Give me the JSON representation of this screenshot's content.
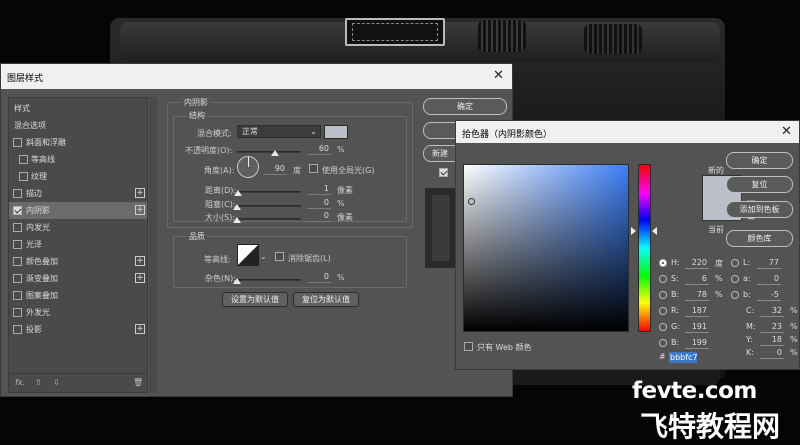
{
  "layer_style": {
    "title": "图层样式",
    "close": "✕",
    "list": [
      {
        "label": "样式",
        "kind": "header"
      },
      {
        "label": "混合选项",
        "kind": "header"
      },
      {
        "label": "斜面和浮雕",
        "kind": "check",
        "checked": false
      },
      {
        "label": "等高线",
        "kind": "subcheck",
        "checked": false
      },
      {
        "label": "纹理",
        "kind": "subcheck",
        "checked": false
      },
      {
        "label": "描边",
        "kind": "check",
        "checked": false,
        "plus": "+"
      },
      {
        "label": "内阴影",
        "kind": "check",
        "checked": true,
        "plus": "+",
        "selected": true
      },
      {
        "label": "内发光",
        "kind": "check",
        "checked": false
      },
      {
        "label": "光泽",
        "kind": "check",
        "checked": false
      },
      {
        "label": "颜色叠加",
        "kind": "check",
        "checked": false,
        "plus": "+"
      },
      {
        "label": "渐变叠加",
        "kind": "check",
        "checked": false,
        "plus": "+"
      },
      {
        "label": "图案叠加",
        "kind": "check",
        "checked": false
      },
      {
        "label": "外发光",
        "kind": "check",
        "checked": false
      },
      {
        "label": "投影",
        "kind": "check",
        "checked": false,
        "plus": "+"
      }
    ],
    "footer": {
      "fx": "fx.",
      "up": "⇧",
      "down": "⇩",
      "trash": "🗑"
    },
    "inner_shadow": {
      "heading": "内阴影",
      "structure": "结构",
      "blend_mode_label": "混合模式:",
      "blend_mode_value": "正常",
      "opacity_label": "不透明度(O):",
      "opacity_value": "60",
      "angle_label": "角度(A):",
      "angle_value": "90",
      "angle_unit": "度",
      "global_light_label": "使用全局光(G)",
      "distance_label": "距离(D):",
      "distance_value": "1",
      "choke_label": "阻塞(C):",
      "choke_value": "0",
      "size_label": "大小(S):",
      "size_value": "0",
      "px_unit": "像素",
      "pct_unit": "%",
      "quality": "品质",
      "contour_label": "等高线:",
      "antialias_label": "消除锯齿(L)",
      "noise_label": "杂色(N):",
      "noise_value": "0",
      "set_default": "设置为默认值",
      "reset_default": "复位为默认值",
      "opacity_fraction": 0.6,
      "distance_fraction": 0.02,
      "choke_fraction": 0,
      "size_fraction": 0,
      "noise_fraction": 0
    },
    "buttons": {
      "ok": "确定",
      "new_style": "新建"
    },
    "swatch_color": "#bbbfc7"
  },
  "picker": {
    "title": "拾色器（内阴影颜色）",
    "close": "✕",
    "new_label": "新的",
    "current_label": "当前",
    "buttons": [
      "确定",
      "复位",
      "添加到色板",
      "颜色库"
    ],
    "web_only_label": "只有 Web 颜色",
    "hsb": [
      {
        "k": "H:",
        "v": "220",
        "u": "度",
        "on": true
      },
      {
        "k": "S:",
        "v": "6",
        "u": "%",
        "on": false
      },
      {
        "k": "B:",
        "v": "78",
        "u": "%",
        "on": false
      }
    ],
    "rgb": [
      {
        "k": "R:",
        "v": "187",
        "on": false
      },
      {
        "k": "G:",
        "v": "191",
        "on": false
      },
      {
        "k": "B:",
        "v": "199",
        "on": false
      }
    ],
    "lab": [
      {
        "k": "L:",
        "v": "77"
      },
      {
        "k": "a:",
        "v": "0"
      },
      {
        "k": "b:",
        "v": "-5"
      }
    ],
    "cmyk": [
      {
        "k": "C:",
        "v": "32",
        "u": "%"
      },
      {
        "k": "M:",
        "v": "23",
        "u": "%"
      },
      {
        "k": "Y:",
        "v": "18",
        "u": "%"
      },
      {
        "k": "K:",
        "v": "0",
        "u": "%"
      }
    ],
    "hash": "#",
    "hex": "bbbfc7",
    "color": "#bbbfc7"
  },
  "watermark": {
    "line1": "fevte.com",
    "line2": "飞特教程网"
  }
}
